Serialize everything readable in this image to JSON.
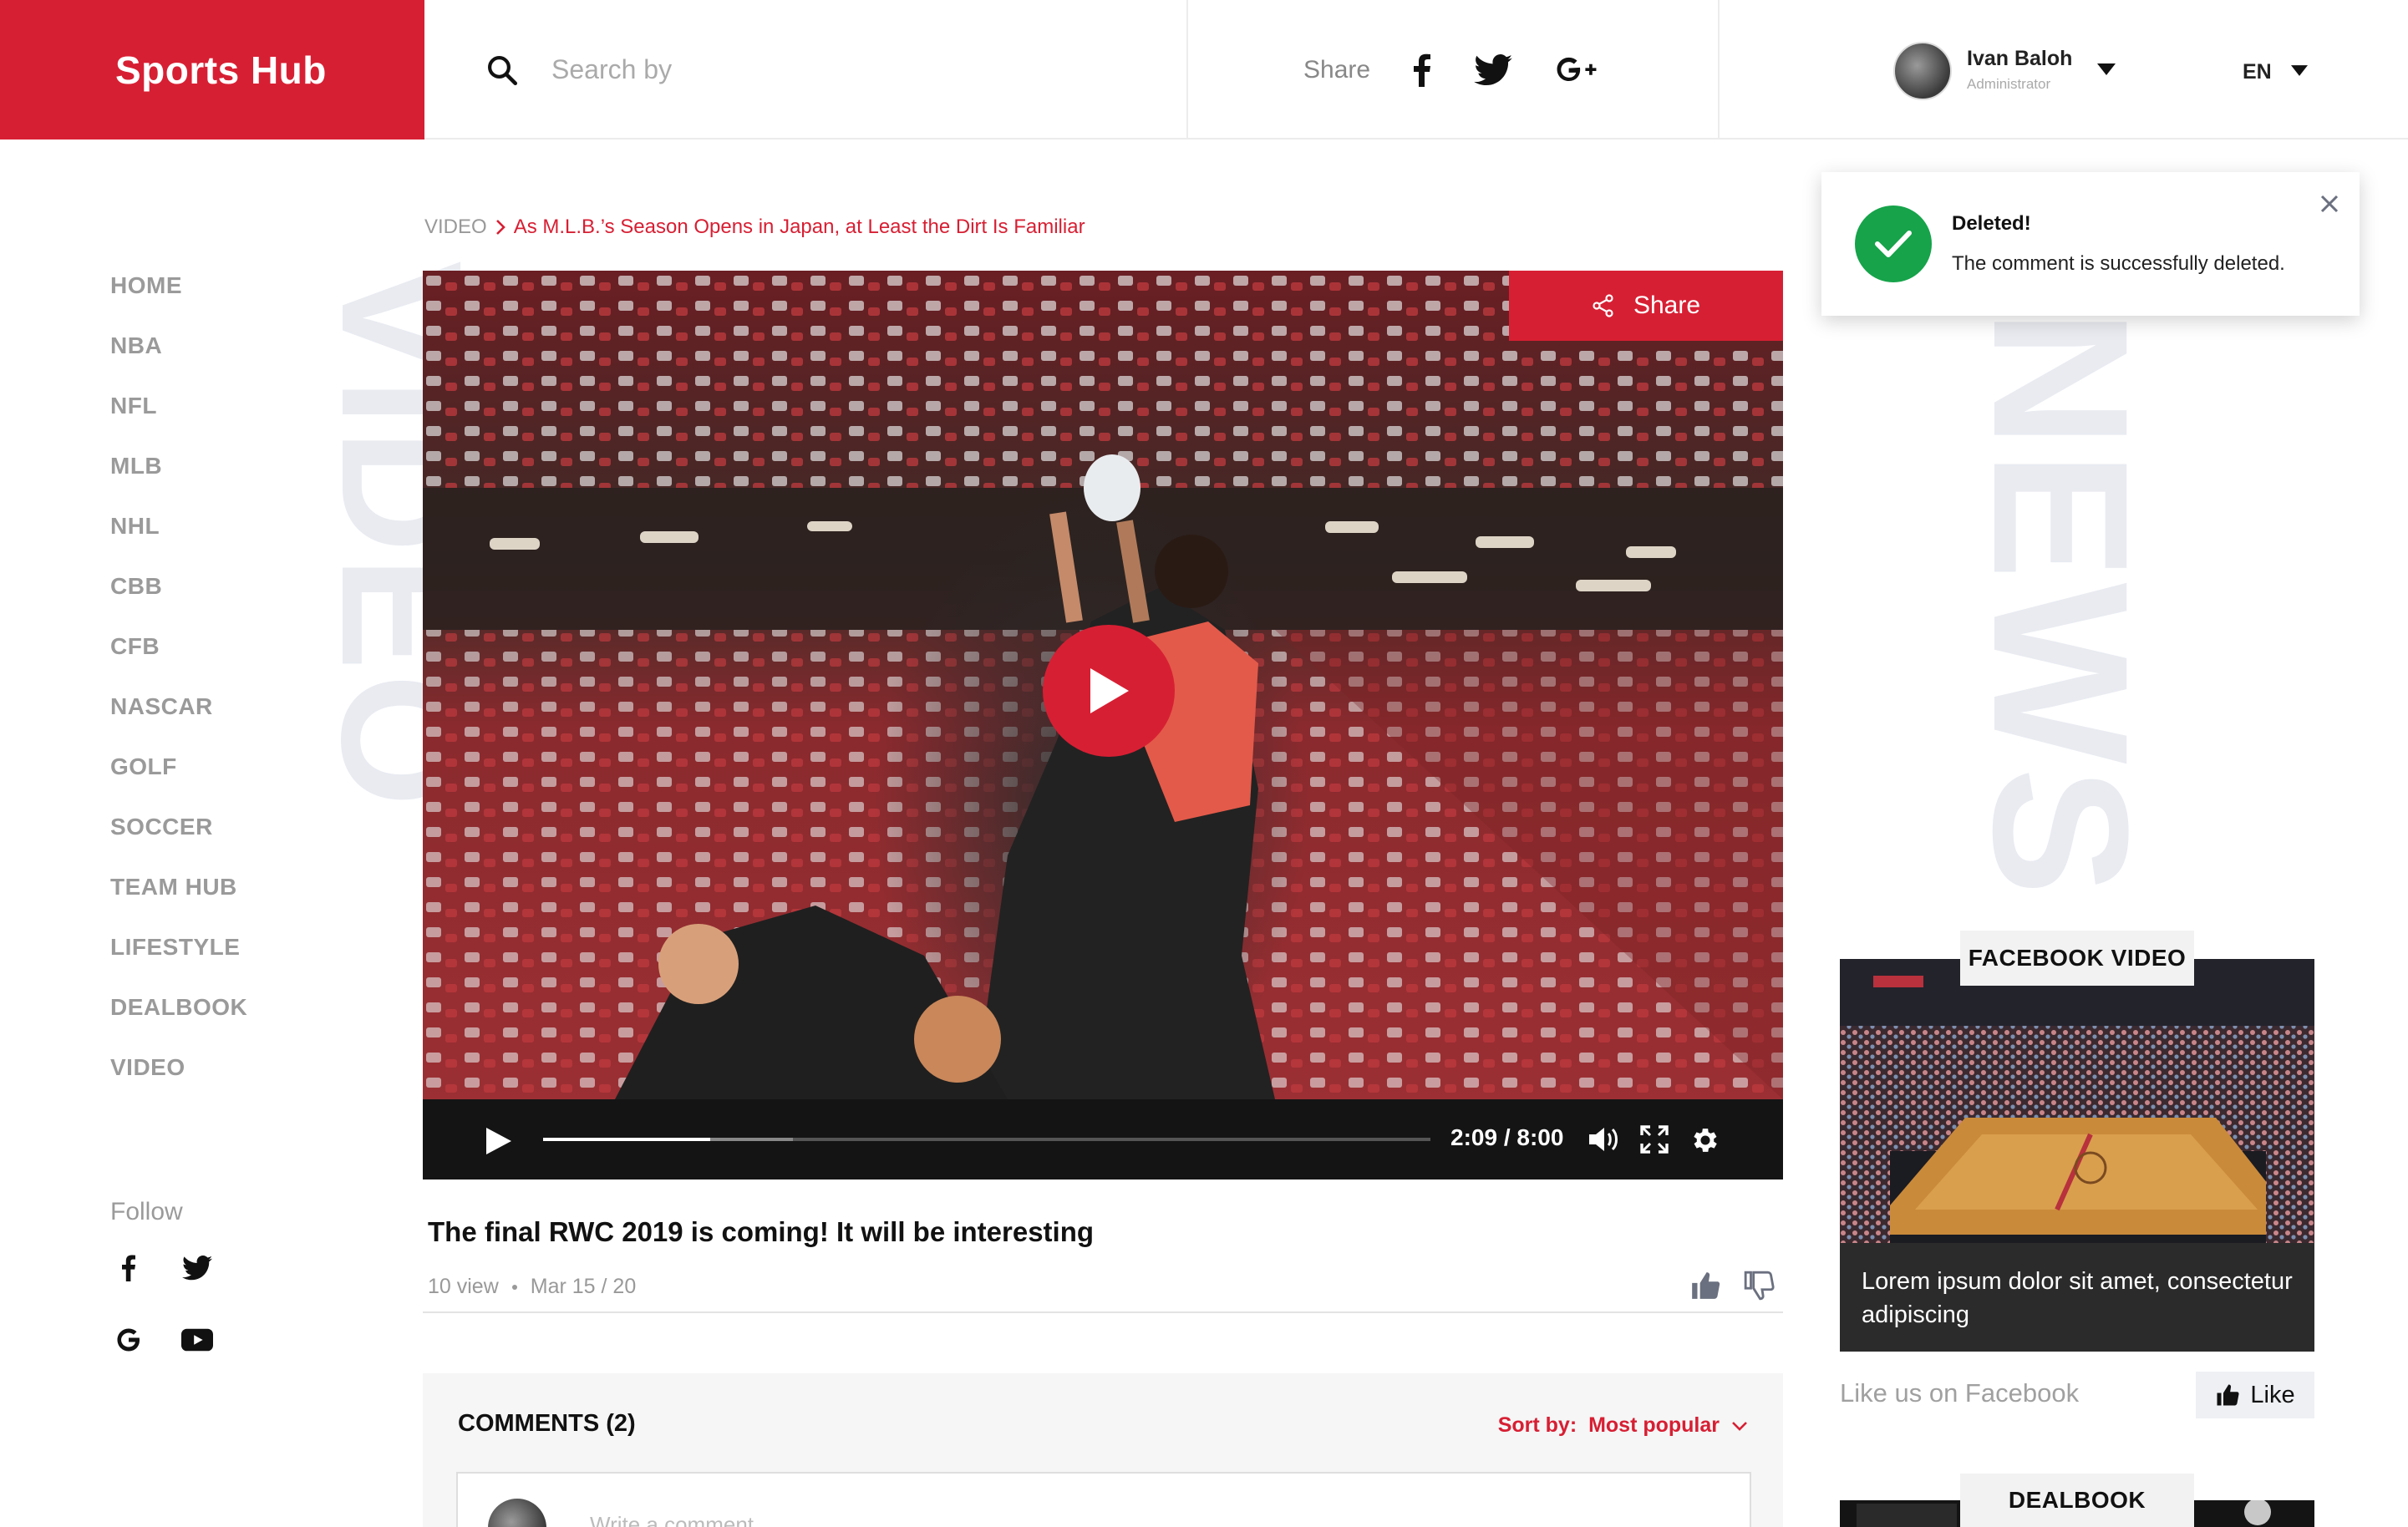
{
  "brand": {
    "name": "Sports Hub",
    "color": "#d71f33"
  },
  "search": {
    "placeholder": "Search by"
  },
  "share_bar": {
    "label": "Share",
    "networks": [
      "facebook-icon",
      "twitter-icon",
      "google-plus-icon"
    ]
  },
  "user": {
    "name": "Ivan Baloh",
    "role": "Administrator",
    "language": "EN"
  },
  "nav": {
    "items": [
      "HOME",
      "NBA",
      "NFL",
      "MLB",
      "NHL",
      "CBB",
      "CFB",
      "NASCAR",
      "GOLF",
      "SOCCER",
      "TEAM HUB",
      "LIFESTYLE",
      "DEALBOOK",
      "VIDEO"
    ],
    "follow_label": "Follow",
    "follow_icons": [
      "facebook-icon",
      "twitter-icon",
      "google-icon",
      "youtube-icon"
    ]
  },
  "background_words": {
    "left": "VIDEO",
    "right": "NEWS"
  },
  "breadcrumb": {
    "root": "VIDEO",
    "current": "As M.L.B.’s Season Opens in Japan, at Least the Dirt Is Familiar"
  },
  "player": {
    "share_label": "Share",
    "time": "2:09 / 8:00",
    "progress": 0.188,
    "buffered": 0.282
  },
  "video": {
    "title": "The final RWC 2019  is coming! It will be interesting",
    "views": "10 view",
    "date": "Mar 15 / 20"
  },
  "comments": {
    "title": "COMMENTS (2)",
    "sort_label": "Sort by:",
    "sort_value": "Most popular",
    "placeholder": "Write a comment"
  },
  "toast": {
    "title": "Deleted!",
    "message": "The comment is successfully deleted.",
    "color": "#16a34a"
  },
  "sidebar": {
    "facebook_video_label": "FACEBOOK  VIDEO",
    "card_text": "Lorem ipsum dolor sit amet, consectetur adipiscing",
    "like_us": "Like us on Facebook",
    "like_button": "Like",
    "dealbook_label": "DEALBOOK"
  }
}
